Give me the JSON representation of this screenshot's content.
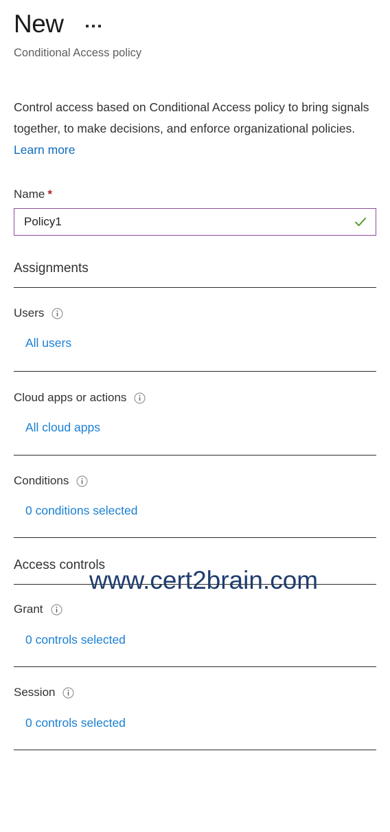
{
  "header": {
    "title": "New",
    "subtitle": "Conditional Access policy",
    "overflow_menu": "···"
  },
  "intro": {
    "description": "Control access based on Conditional Access policy to bring signals together, to make decisions, and enforce organizational policies.",
    "learn_more_label": "Learn more"
  },
  "name_field": {
    "label": "Name",
    "required_marker": "*",
    "value": "Policy1",
    "placeholder": "",
    "validation_state": "valid",
    "validation_icon": "checkmark-icon"
  },
  "assignments": {
    "section_title": "Assignments",
    "rows": [
      {
        "label": "Users",
        "info_icon": "info-icon",
        "value_label": "All users"
      },
      {
        "label": "Cloud apps or actions",
        "info_icon": "info-icon",
        "value_label": "All cloud apps"
      },
      {
        "label": "Conditions",
        "info_icon": "info-icon",
        "value_label": "0 conditions selected"
      }
    ]
  },
  "access_controls": {
    "section_title": "Access controls",
    "rows": [
      {
        "label": "Grant",
        "info_icon": "info-icon",
        "value_label": "0 controls selected"
      },
      {
        "label": "Session",
        "info_icon": "info-icon",
        "value_label": "0 controls selected"
      }
    ]
  },
  "watermark": {
    "text": "www.cert2brain.com"
  },
  "colors": {
    "link": "#1a7fd4",
    "learn_more_link": "#0f6cbd",
    "required_asterisk": "#a4262c",
    "input_border": "#8e4a9e",
    "valid_check": "#4f9a20",
    "divider": "#2b2b2b",
    "subtitle_text": "#605e5c",
    "watermark": "#1f3d6e"
  }
}
